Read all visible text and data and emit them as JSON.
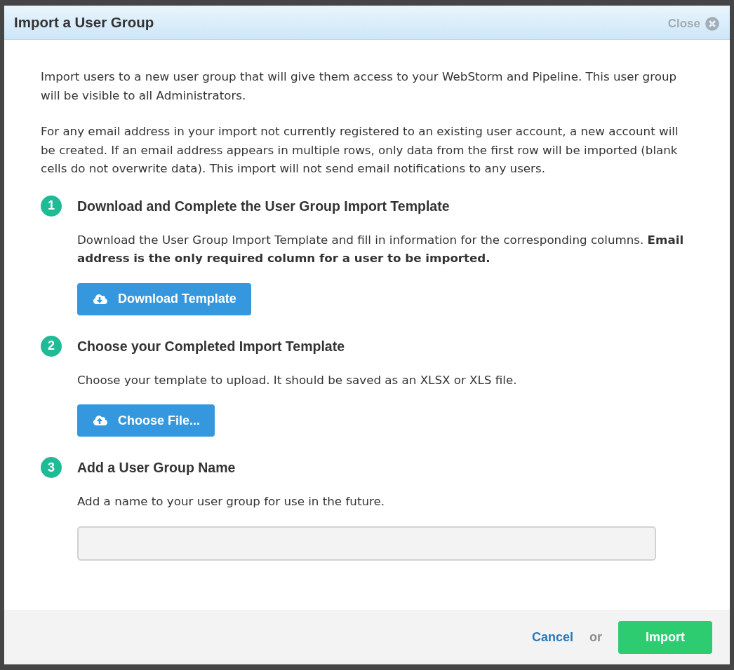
{
  "dialog": {
    "title": "Import a User Group",
    "close_label": "Close"
  },
  "intro": [
    "Import users to a new user group that will give them access to your WebStorm and Pipeline. This user group will be visible to all Administrators.",
    "For any email address in your import not currently registered to an existing user account, a new account will be created. If an email address appears in multiple rows, only data from the first row will be imported (blank cells do not overwrite data). This import will not send email notifications to any users."
  ],
  "steps": [
    {
      "number": "1",
      "title": "Download and Complete the User Group Import Template",
      "description": "Download the User Group Import Template and fill in information for the corresponding columns. **Email address is the only required column for a user to be imported.**",
      "action": {
        "kind": "download_button",
        "label": "Download Template"
      }
    },
    {
      "number": "2",
      "title": "Choose your Completed Import Template",
      "description": "Choose your template to upload. It should be saved as an XLSX or XLS file.",
      "action": {
        "kind": "upload_button",
        "label": "Choose File..."
      }
    },
    {
      "number": "3",
      "title": "Add a User Group Name",
      "description": "Add a name to your user group for use in the future.",
      "action": {
        "kind": "text_field"
      }
    }
  ],
  "footer": {
    "cancel_label": "Cancel",
    "separator": "or",
    "submit_label": "Import"
  }
}
